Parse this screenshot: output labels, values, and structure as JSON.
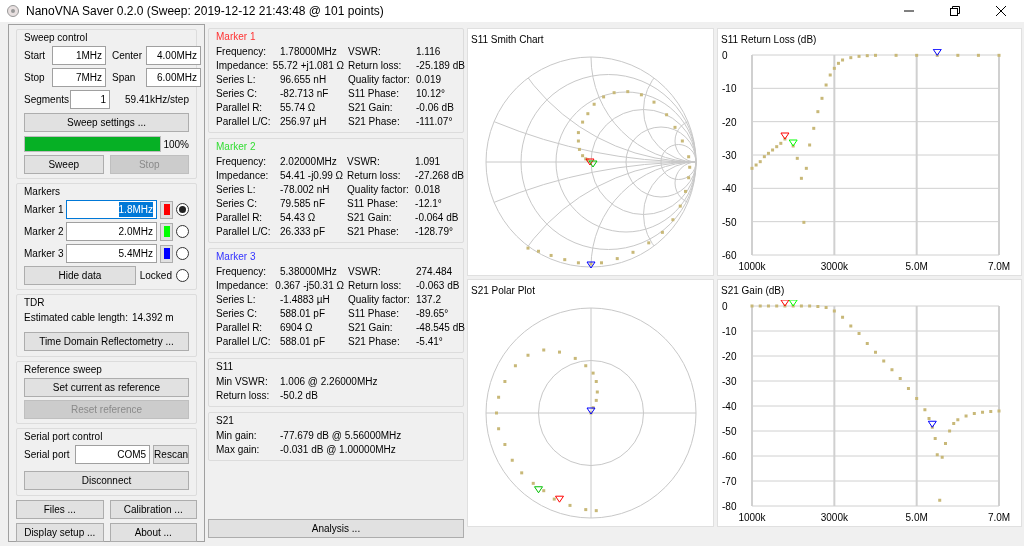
{
  "window": {
    "title": "NanoVNA Saver 0.2.0 (Sweep: 2019-12-12 21:43:48 @ 101 points)"
  },
  "sweep_control": {
    "title": "Sweep control",
    "fields": [
      {
        "label": "Start",
        "value": "1MHz"
      },
      {
        "label": "Center",
        "value": "4.00MHz"
      },
      {
        "label": "Stop",
        "value": "7MHz"
      },
      {
        "label": "Span",
        "value": "6.00MHz"
      }
    ],
    "segments": {
      "label": "Segments",
      "value": "1"
    },
    "step": "59.41kHz/step",
    "settings_button": "Sweep settings ...",
    "progress": {
      "level": 1,
      "reading": "100%"
    },
    "buttons": [
      {
        "label": "Sweep",
        "disabled": false
      },
      {
        "label": "Stop",
        "disabled": true
      }
    ]
  },
  "markers": {
    "title": "Markers",
    "items": [
      {
        "label": "Marker 1",
        "value": "1.8MHz",
        "color": "#ff0000",
        "highlighted": true,
        "selected": true
      },
      {
        "label": "Marker 2",
        "value": "2.0MHz",
        "color": "#00ff00",
        "highlighted": false,
        "selected": false
      },
      {
        "label": "Marker 3",
        "value": "5.4MHz",
        "color": "#0000ff",
        "highlighted": false,
        "selected": false
      }
    ],
    "hide_button": "Hide data",
    "locked": {
      "label": "Locked",
      "checked": false
    }
  },
  "tdr": {
    "title": "TDR",
    "label": "Estimated cable length:",
    "value": "14.392 m",
    "button": "Time Domain Reflectometry ..."
  },
  "reference_sweep": {
    "title": "Reference sweep",
    "buttons": [
      {
        "label": "Set current as reference",
        "disabled": false
      },
      {
        "label": "Reset reference",
        "disabled": true
      }
    ]
  },
  "serial_port": {
    "title": "Serial port control",
    "label": "Serial port",
    "value": "COM5",
    "rescan_button": "Rescan",
    "disconnect_button": "Disconnect"
  },
  "bottom_buttons": [
    "Files ...",
    "Calibration ...",
    "Display setup ...",
    "About ..."
  ],
  "marker_details": [
    {
      "title": "Marker 1",
      "color": "#ff3333",
      "left": [
        {
          "label": "Frequency:",
          "value": "1.78000MHz"
        },
        {
          "label": "Impedance:",
          "value": "55.72 +j1.081 Ω"
        },
        {
          "label": "Series L:",
          "value": "96.655 nH"
        },
        {
          "label": "Series C:",
          "value": "-82.713 nF"
        },
        {
          "label": "Parallel R:",
          "value": "55.74 Ω"
        },
        {
          "label": "Parallel L/C:",
          "value": "256.97 µH"
        }
      ],
      "right": [
        {
          "label": "VSWR:",
          "value": "1.116"
        },
        {
          "label": "Return loss:",
          "value": "-25.189 dB"
        },
        {
          "label": "Quality factor:",
          "value": "0.019"
        },
        {
          "label": "S11 Phase:",
          "value": "10.12°"
        },
        {
          "label": "S21 Gain:",
          "value": "-0.06 dB"
        },
        {
          "label": "S21 Phase:",
          "value": "-111.07°"
        }
      ]
    },
    {
      "title": "Marker 2",
      "color": "#33dd33",
      "left": [
        {
          "label": "Frequency:",
          "value": "2.02000MHz"
        },
        {
          "label": "Impedance:",
          "value": "54.41 -j0.99 Ω"
        },
        {
          "label": "Series L:",
          "value": "-78.002 nH"
        },
        {
          "label": "Series C:",
          "value": "79.585 nF"
        },
        {
          "label": "Parallel R:",
          "value": "54.43 Ω"
        },
        {
          "label": "Parallel L/C:",
          "value": "26.333 pF"
        }
      ],
      "right": [
        {
          "label": "VSWR:",
          "value": "1.091"
        },
        {
          "label": "Return loss:",
          "value": "-27.268 dB"
        },
        {
          "label": "Quality factor:",
          "value": "0.018"
        },
        {
          "label": "S11 Phase:",
          "value": "-12.1°"
        },
        {
          "label": "S21 Gain:",
          "value": "-0.064 dB"
        },
        {
          "label": "S21 Phase:",
          "value": "-128.79°"
        }
      ]
    },
    {
      "title": "Marker 3",
      "color": "#3333ff",
      "left": [
        {
          "label": "Frequency:",
          "value": "5.38000MHz"
        },
        {
          "label": "Impedance:",
          "value": "0.367 -j50.31 Ω"
        },
        {
          "label": "Series L:",
          "value": "-1.4883 µH"
        },
        {
          "label": "Series C:",
          "value": "588.01 pF"
        },
        {
          "label": "Parallel R:",
          "value": "6904 Ω"
        },
        {
          "label": "Parallel L/C:",
          "value": "588.01 pF"
        }
      ],
      "right": [
        {
          "label": "VSWR:",
          "value": "274.484"
        },
        {
          "label": "Return loss:",
          "value": "-0.063 dB"
        },
        {
          "label": "Quality factor:",
          "value": "137.2"
        },
        {
          "label": "S11 Phase:",
          "value": "-89.65°"
        },
        {
          "label": "S21 Gain:",
          "value": "-48.545 dB"
        },
        {
          "label": "S21 Phase:",
          "value": "-5.41°"
        }
      ]
    }
  ],
  "s11": {
    "title": "S11",
    "rows": [
      {
        "label": "Min VSWR:",
        "value": "1.006 @ 2.26000MHz"
      },
      {
        "label": "Return loss:",
        "value": "-50.2 dB"
      }
    ]
  },
  "s21": {
    "title": "S21",
    "rows": [
      {
        "label": "Min gain:",
        "value": "-77.679 dB @ 5.56000MHz"
      },
      {
        "label": "Max gain:",
        "value": "-0.031 dB @ 1.00000MHz"
      }
    ]
  },
  "analysis_button": "Analysis ...",
  "charts": [
    {
      "kind": "smith",
      "title": "S11 Smith Chart"
    },
    {
      "kind": "plot",
      "chart_data": {
        "type": "scatter",
        "title": "S11 Return Loss (dB)",
        "x": [
          1000000,
          1100000,
          1200000,
          1300000,
          1400000,
          1500000,
          1600000,
          1700000,
          1800000,
          2000000,
          2100000,
          2200000,
          2260000,
          2320000,
          2400000,
          2500000,
          2600000,
          2700000,
          2800000,
          2900000,
          3000000,
          3100000,
          3200000,
          3400000,
          3600000,
          3800000,
          4000000,
          4500000,
          5000000,
          5500000,
          6000000,
          6500000,
          7000000
        ],
        "series": [
          {
            "color": "#c8b878",
            "values": [
              -34,
              -33,
              -32,
              -30.5,
              -29.5,
              -28.5,
              -27.5,
              -26.5,
              -25.2,
              -27.3,
              -31,
              -37,
              -50.2,
              -34,
              -27,
              -22,
              -17,
              -13,
              -9,
              -6,
              -4,
              -2.5,
              -1.5,
              -0.8,
              -0.4,
              -0.2,
              -0.1,
              -0.1,
              -0.1,
              -0.1,
              -0.1,
              -0.1,
              -0.1
            ]
          }
        ],
        "xlim": [
          1000000,
          7000000
        ],
        "ylim": [
          -60,
          0
        ],
        "grid": true,
        "xticks": [
          {
            "value": 1000000,
            "label": "1000k"
          },
          {
            "value": 3000000,
            "label": "3000k"
          },
          {
            "value": 5000000,
            "label": "5.0M"
          },
          {
            "value": 7000000,
            "label": "7.0M"
          }
        ],
        "yticks": [
          0,
          -10,
          -20,
          -30,
          -40,
          -50,
          -60
        ]
      }
    },
    {
      "kind": "polar",
      "title": "S21 Polar Plot"
    },
    {
      "kind": "plot",
      "chart_data": {
        "type": "scatter",
        "title": "S21 Gain (dB)",
        "x": [
          1000000,
          1200000,
          1400000,
          1600000,
          1800000,
          2000000,
          2200000,
          2400000,
          2600000,
          2800000,
          3000000,
          3200000,
          3400000,
          3600000,
          3800000,
          4000000,
          4200000,
          4400000,
          4600000,
          4800000,
          5000000,
          5200000,
          5300000,
          5380000,
          5450000,
          5500000,
          5560000,
          5620000,
          5700000,
          5800000,
          5900000,
          6000000,
          6200000,
          6400000,
          6600000,
          6800000,
          7000000
        ],
        "series": [
          {
            "color": "#c8b878",
            "values": [
              0,
              0,
              0,
              0,
              0,
              0,
              0,
              0,
              -0.2,
              -0.6,
              -2,
              -4.5,
              -8,
              -11,
              -15,
              -18.5,
              -22,
              -25.5,
              -29,
              -33,
              -37,
              -41.5,
              -45,
              -48.5,
              -53,
              -59.5,
              -77.7,
              -60.5,
              -55,
              -50,
              -47,
              -45.5,
              -44,
              -43,
              -42.5,
              -42.2,
              -42
            ]
          }
        ],
        "xlim": [
          1000000,
          7000000
        ],
        "ylim": [
          -80,
          0
        ],
        "grid": true,
        "xticks": [
          {
            "value": 1000000,
            "label": "1000k"
          },
          {
            "value": 3000000,
            "label": "3000k"
          },
          {
            "value": 5000000,
            "label": "5.0M"
          },
          {
            "value": 7000000,
            "label": "7.0M"
          }
        ],
        "yticks": [
          0,
          -10,
          -20,
          -30,
          -40,
          -50,
          -60,
          -70,
          -80
        ]
      }
    }
  ]
}
